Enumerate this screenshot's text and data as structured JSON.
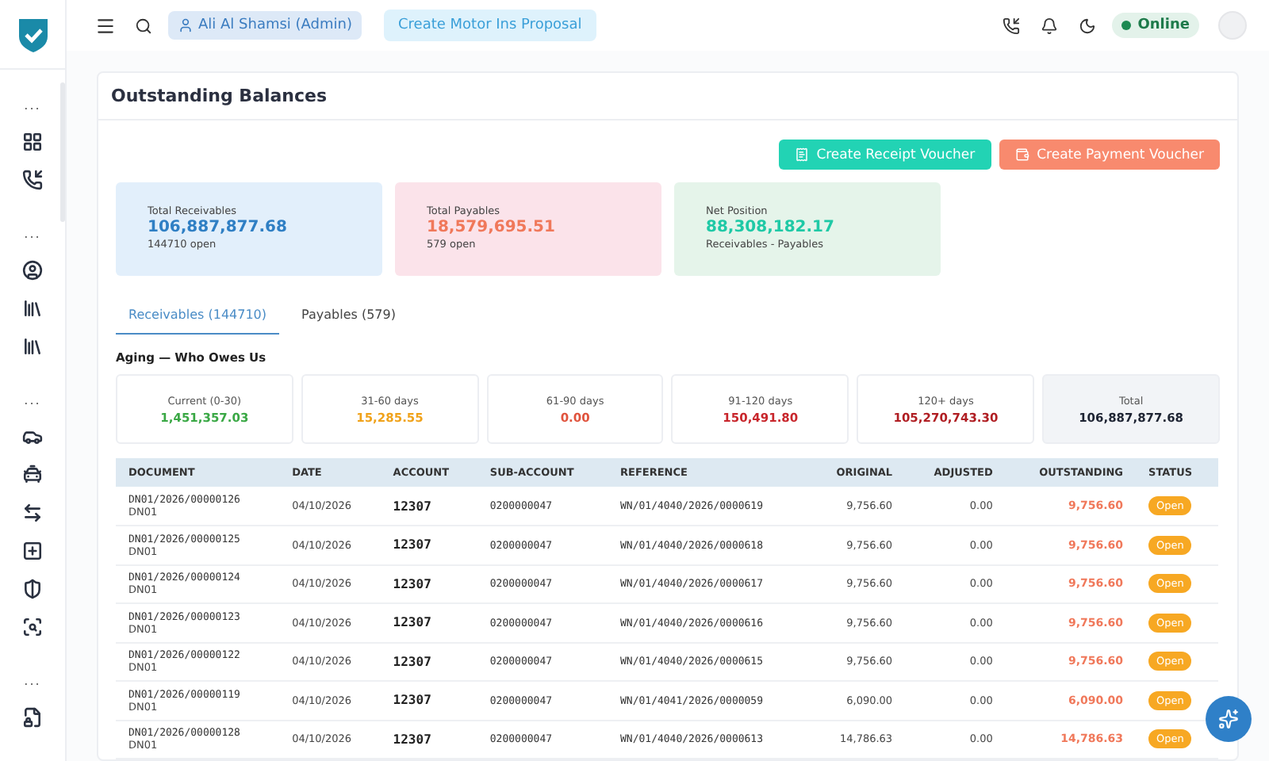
{
  "topbar": {
    "user": "Ali Al Shamsi (Admin)",
    "action": "Create Motor Ins Proposal",
    "status": "Online"
  },
  "sidebar": {
    "sections": [
      {
        "label": "...",
        "items": [
          {
            "kind": "grid"
          },
          {
            "kind": "phone"
          }
        ]
      },
      {
        "label": "...",
        "items": [
          {
            "kind": "user"
          },
          {
            "kind": "building"
          },
          {
            "kind": "building"
          }
        ]
      },
      {
        "label": "...",
        "items": [
          {
            "kind": "car"
          },
          {
            "kind": "car-off"
          },
          {
            "kind": "transfer"
          },
          {
            "kind": "plus"
          },
          {
            "kind": "shield"
          },
          {
            "kind": "search"
          }
        ]
      },
      {
        "label": "...",
        "items": [
          {
            "kind": "file"
          }
        ]
      }
    ]
  },
  "page": {
    "title": "Outstanding Balances",
    "buttons": [
      {
        "label": "Create Receipt Voucher",
        "kind": "receipt"
      },
      {
        "label": "Create Payment Voucher",
        "kind": "payment"
      }
    ]
  },
  "summary": [
    {
      "label": "Total Receivables",
      "value": "106,887,877.68",
      "note": "144710 open",
      "color": "#2f7fc4"
    },
    {
      "label": "Total Payables",
      "value": "18,579,695.51",
      "note": "579 open",
      "color": "#f0785a"
    },
    {
      "label": "Net Position",
      "value": "88,308,182.17",
      "note": "Receivables - Payables",
      "color": "#1fc9a6"
    }
  ],
  "tabs": [
    {
      "label": "Receivables (144710)",
      "selected": true
    },
    {
      "label": "Payables (579)",
      "selected": false
    }
  ],
  "aging": {
    "title": "Aging — Who Owes Us",
    "buckets": [
      {
        "label": "Current (0-30)",
        "value": "1,451,357.03",
        "color": "#3aa845"
      },
      {
        "label": "31-60 days",
        "value": "15,285.55",
        "color": "#f0a21a"
      },
      {
        "label": "61-90 days",
        "value": "0.00",
        "color": "#e0533d"
      },
      {
        "label": "91-120 days",
        "value": "150,491.80",
        "color": "#c8262c"
      },
      {
        "label": "120+ days",
        "value": "105,270,743.30",
        "color": "#b01e23"
      },
      {
        "label": "Total",
        "value": "106,887,877.68",
        "color": "#1e2433",
        "kind": "total"
      }
    ]
  },
  "table": {
    "columns": [
      "DOCUMENT",
      "DATE",
      "ACCOUNT",
      "SUB-ACCOUNT",
      "REFERENCE",
      "ORIGINAL",
      "ADJUSTED",
      "OUTSTANDING",
      "STATUS"
    ],
    "rows": [
      {
        "document": "DN01/2026/00000126",
        "doc_type": "DN01",
        "date": "04/10/2026",
        "account": "12307",
        "sub_account": "0200000047",
        "reference": "WN/01/4040/2026/0000619",
        "original": "9,756.60",
        "adjusted": "0.00",
        "outstanding": "9,756.60",
        "status": "Open"
      },
      {
        "document": "DN01/2026/00000125",
        "doc_type": "DN01",
        "date": "04/10/2026",
        "account": "12307",
        "sub_account": "0200000047",
        "reference": "WN/01/4040/2026/0000618",
        "original": "9,756.60",
        "adjusted": "0.00",
        "outstanding": "9,756.60",
        "status": "Open"
      },
      {
        "document": "DN01/2026/00000124",
        "doc_type": "DN01",
        "date": "04/10/2026",
        "account": "12307",
        "sub_account": "0200000047",
        "reference": "WN/01/4040/2026/0000617",
        "original": "9,756.60",
        "adjusted": "0.00",
        "outstanding": "9,756.60",
        "status": "Open"
      },
      {
        "document": "DN01/2026/00000123",
        "doc_type": "DN01",
        "date": "04/10/2026",
        "account": "12307",
        "sub_account": "0200000047",
        "reference": "WN/01/4040/2026/0000616",
        "original": "9,756.60",
        "adjusted": "0.00",
        "outstanding": "9,756.60",
        "status": "Open"
      },
      {
        "document": "DN01/2026/00000122",
        "doc_type": "DN01",
        "date": "04/10/2026",
        "account": "12307",
        "sub_account": "0200000047",
        "reference": "WN/01/4040/2026/0000615",
        "original": "9,756.60",
        "adjusted": "0.00",
        "outstanding": "9,756.60",
        "status": "Open"
      },
      {
        "document": "DN01/2026/00000119",
        "doc_type": "DN01",
        "date": "04/10/2026",
        "account": "12307",
        "sub_account": "0200000047",
        "reference": "WN/01/4041/2026/0000059",
        "original": "6,090.00",
        "adjusted": "0.00",
        "outstanding": "6,090.00",
        "status": "Open"
      },
      {
        "document": "DN01/2026/00000128",
        "doc_type": "DN01",
        "date": "04/10/2026",
        "account": "12307",
        "sub_account": "0200000047",
        "reference": "WN/01/4040/2026/0000613",
        "original": "14,786.63",
        "adjusted": "0.00",
        "outstanding": "14,786.63",
        "status": "Open"
      }
    ]
  }
}
